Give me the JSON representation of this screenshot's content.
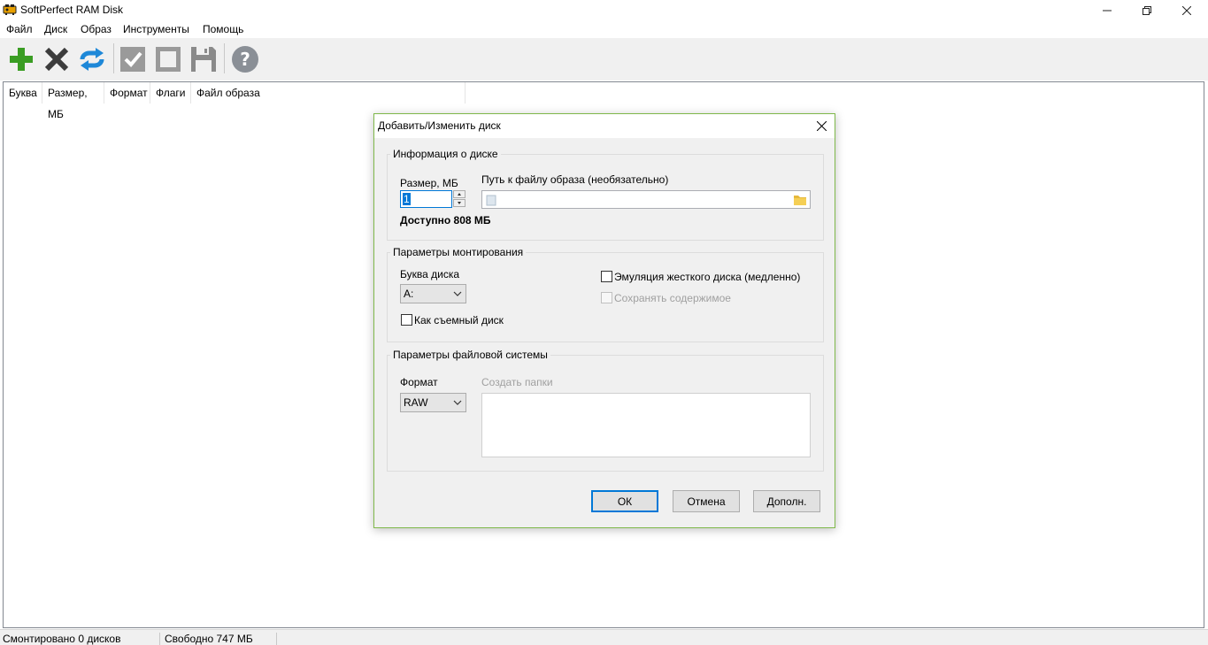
{
  "window": {
    "title": "SoftPerfect RAM Disk"
  },
  "menu": {
    "items": [
      "Файл",
      "Диск",
      "Образ",
      "Инструменты",
      "Помощь"
    ]
  },
  "toolbar": {
    "icons": [
      "add-icon",
      "remove-icon",
      "refresh-icon",
      "check-icon",
      "square-icon",
      "save-icon",
      "help-icon"
    ]
  },
  "list": {
    "columns": [
      "Буква",
      "Размер, МБ",
      "Формат",
      "Флаги",
      "Файл образа"
    ]
  },
  "status": {
    "mounted": "Смонтировано 0 дисков",
    "free": "Свободно 747 МБ"
  },
  "dialog": {
    "title": "Добавить/Изменить диск",
    "disk_info": {
      "group_title": "Информация о диске",
      "size_label": "Размер, МБ",
      "size_value": "1",
      "path_label": "Путь к файлу образа (необязательно)",
      "path_value": "",
      "available": "Доступно 808 МБ"
    },
    "mount": {
      "group_title": "Параметры монтирования",
      "letter_label": "Буква диска",
      "letter_value": "A:",
      "removable_label": "Как съемный диск",
      "hdd_emulation_label": "Эмуляция жесткого диска (медленно)",
      "keep_contents_label": "Сохранять содержимое"
    },
    "fs": {
      "group_title": "Параметры файловой системы",
      "format_label": "Формат",
      "format_value": "RAW",
      "folders_label": "Создать папки",
      "folders_value": ""
    },
    "buttons": {
      "ok": "ОК",
      "cancel": "Отмена",
      "more": "Дополн."
    }
  },
  "colors": {
    "accent": "#0078d7",
    "dialog_border": "#7fb84a",
    "add_green": "#3a9d23",
    "refresh_blue": "#1e88d8",
    "help_gray": "#8a8f96"
  }
}
